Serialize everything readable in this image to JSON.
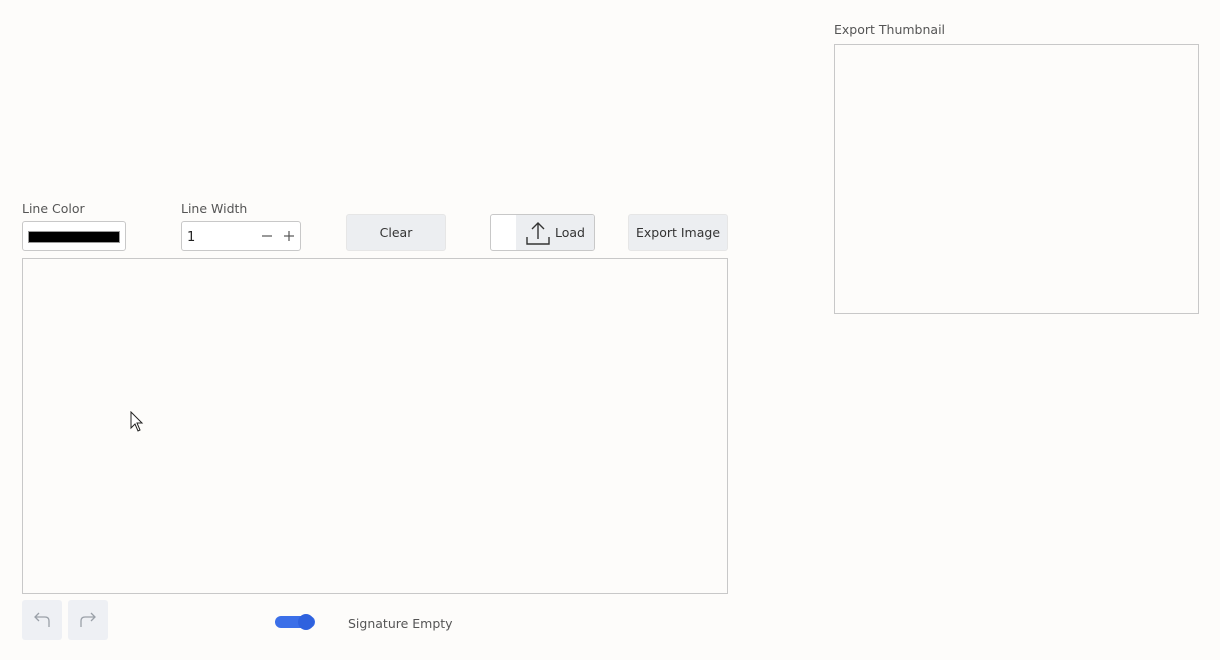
{
  "toolbar": {
    "line_color_label": "Line Color",
    "line_color_value": "#000000",
    "line_width_label": "Line Width",
    "line_width_value": "1",
    "clear_label": "Clear",
    "load_label": "Load",
    "export_label": "Export Image"
  },
  "thumbnail": {
    "label": "Export Thumbnail"
  },
  "footer": {
    "status_text": "Signature Empty",
    "toggle_on": true
  },
  "icons": {
    "decrement": "minus-icon",
    "increment": "plus-icon",
    "upload": "upload-icon",
    "undo": "undo-icon",
    "redo": "redo-icon",
    "cursor": "mouse-cursor-icon"
  },
  "colors": {
    "accent": "#3b6fe8",
    "button_bg": "#eceef1"
  }
}
